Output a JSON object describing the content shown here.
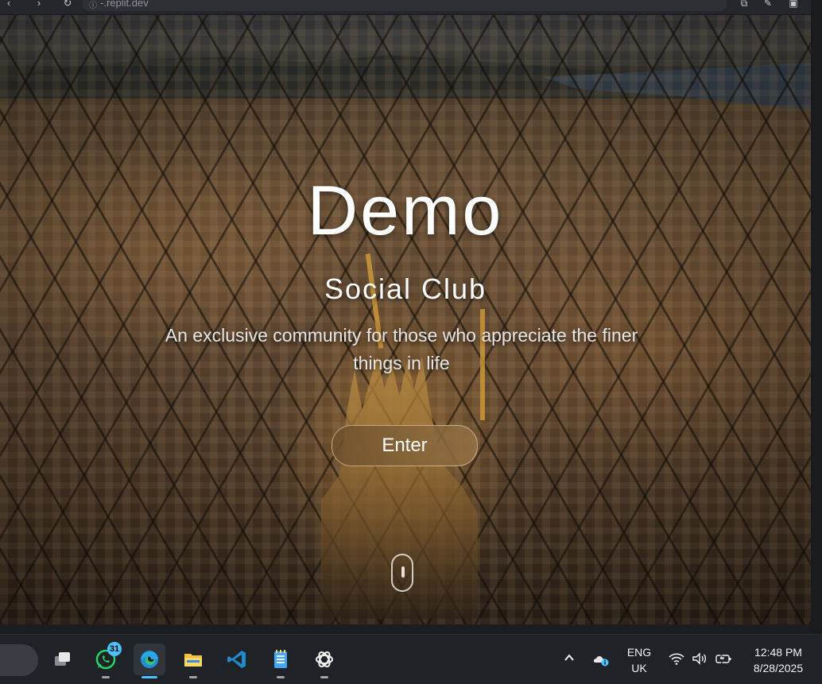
{
  "browser": {
    "url": "-.replit.dev"
  },
  "hero": {
    "title": "Demo",
    "subtitle": "Social Club",
    "tagline": "An exclusive community for those who appreciate the finer things in life",
    "enter_label": "Enter"
  },
  "taskbar": {
    "apps": [
      {
        "name": "WhatsApp",
        "icon": "whatsapp-icon",
        "badge": "31"
      },
      {
        "name": "Microsoft Edge",
        "icon": "edge-icon",
        "active": true
      },
      {
        "name": "File Explorer",
        "icon": "folder-icon"
      },
      {
        "name": "Visual Studio Code",
        "icon": "vscode-icon"
      },
      {
        "name": "Notepad",
        "icon": "notepad-icon"
      },
      {
        "name": "ChatGPT",
        "icon": "chatgpt-icon"
      }
    ],
    "language_line1": "ENG",
    "language_line2": "UK",
    "time": "12:48 PM",
    "date": "8/28/2025"
  }
}
